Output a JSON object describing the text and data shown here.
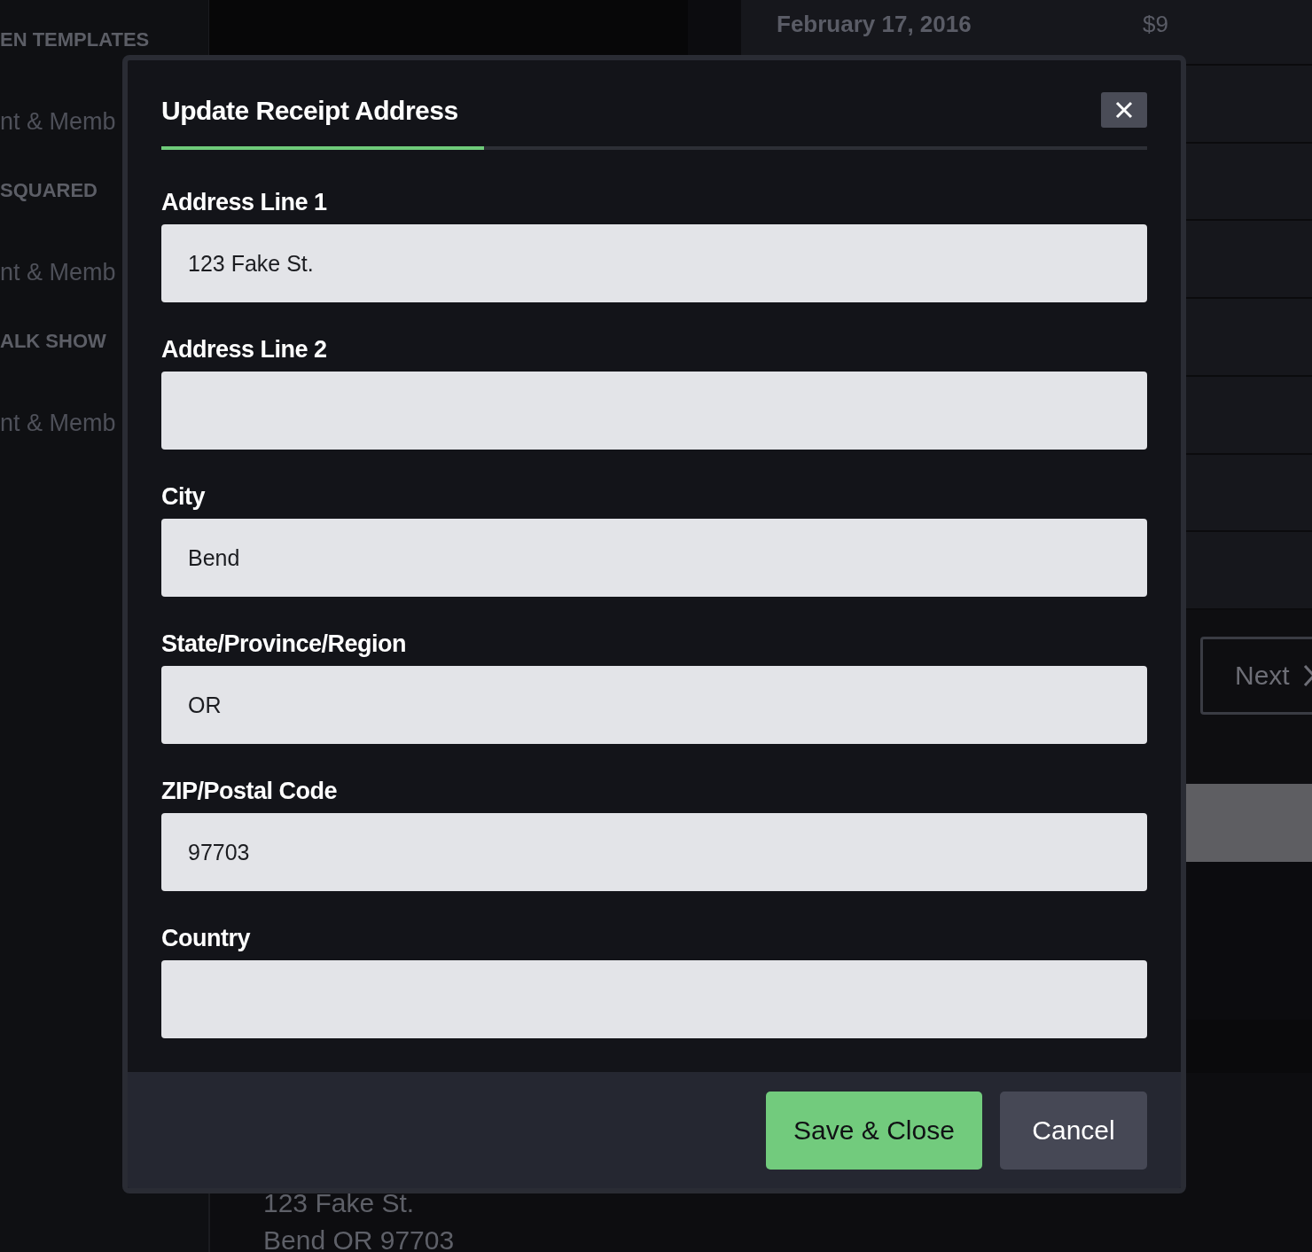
{
  "background": {
    "sidebar": {
      "items": [
        {
          "kind": "heading",
          "text": "EN TEMPLATES"
        },
        {
          "kind": "item",
          "text": "nt & Memb"
        },
        {
          "kind": "heading",
          "text": "SQUARED"
        },
        {
          "kind": "item",
          "text": "nt & Memb"
        },
        {
          "kind": "heading",
          "text": "ALK SHOW"
        },
        {
          "kind": "item",
          "text": "nt & Memb"
        }
      ]
    },
    "receipts": {
      "date": "February 17, 2016",
      "amount": "$9"
    },
    "pagination": {
      "next": "Next"
    },
    "address": [
      "123 Fake St.",
      "Bend OR 97703"
    ]
  },
  "modal": {
    "title": "Update Receipt Address",
    "fields": [
      {
        "label": "Address Line 1",
        "value": "123 Fake St."
      },
      {
        "label": "Address Line 2"
      },
      {
        "label": "City",
        "value": "Bend"
      },
      {
        "label": "State/Province/Region",
        "value": "OR"
      },
      {
        "label": "ZIP/Postal Code",
        "value": "97703"
      },
      {
        "label": "Country"
      }
    ],
    "buttons": [
      {
        "kind": "primary",
        "label": "Save & Close"
      },
      {
        "kind": "secondary",
        "label": "Cancel"
      }
    ]
  }
}
